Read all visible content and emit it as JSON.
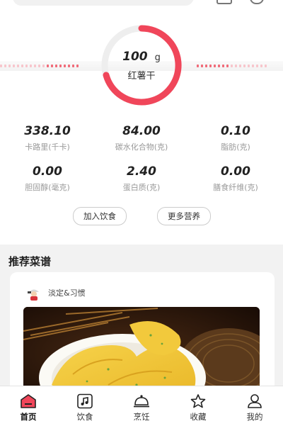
{
  "food": {
    "weight": "100",
    "unit": "g",
    "name": "红薯干"
  },
  "nutrients": [
    {
      "value": "338.10",
      "label": "卡路里(千卡)"
    },
    {
      "value": "84.00",
      "label": "碳水化合物(克)"
    },
    {
      "value": "0.10",
      "label": "脂肪(克)"
    },
    {
      "value": "0.00",
      "label": "胆固醇(毫克)"
    },
    {
      "value": "2.40",
      "label": "蛋白质(克)"
    },
    {
      "value": "0.00",
      "label": "膳食纤维(克)"
    }
  ],
  "actions": {
    "add_diet": "加入饮食",
    "more_nutrition": "更多营养"
  },
  "recommend": {
    "title": "推荐菜谱",
    "author": "淡定&习惯"
  },
  "tabbar": [
    {
      "label": "首页",
      "icon": "home-icon",
      "active": true
    },
    {
      "label": "饮食",
      "icon": "diet-icon",
      "active": false
    },
    {
      "label": "烹饪",
      "icon": "cooking-icon",
      "active": false
    },
    {
      "label": "收藏",
      "icon": "star-icon",
      "active": false
    },
    {
      "label": "我的",
      "icon": "user-icon",
      "active": false
    }
  ],
  "colors": {
    "accent": "#f0465a",
    "gauge_track": "#eeeeee"
  }
}
